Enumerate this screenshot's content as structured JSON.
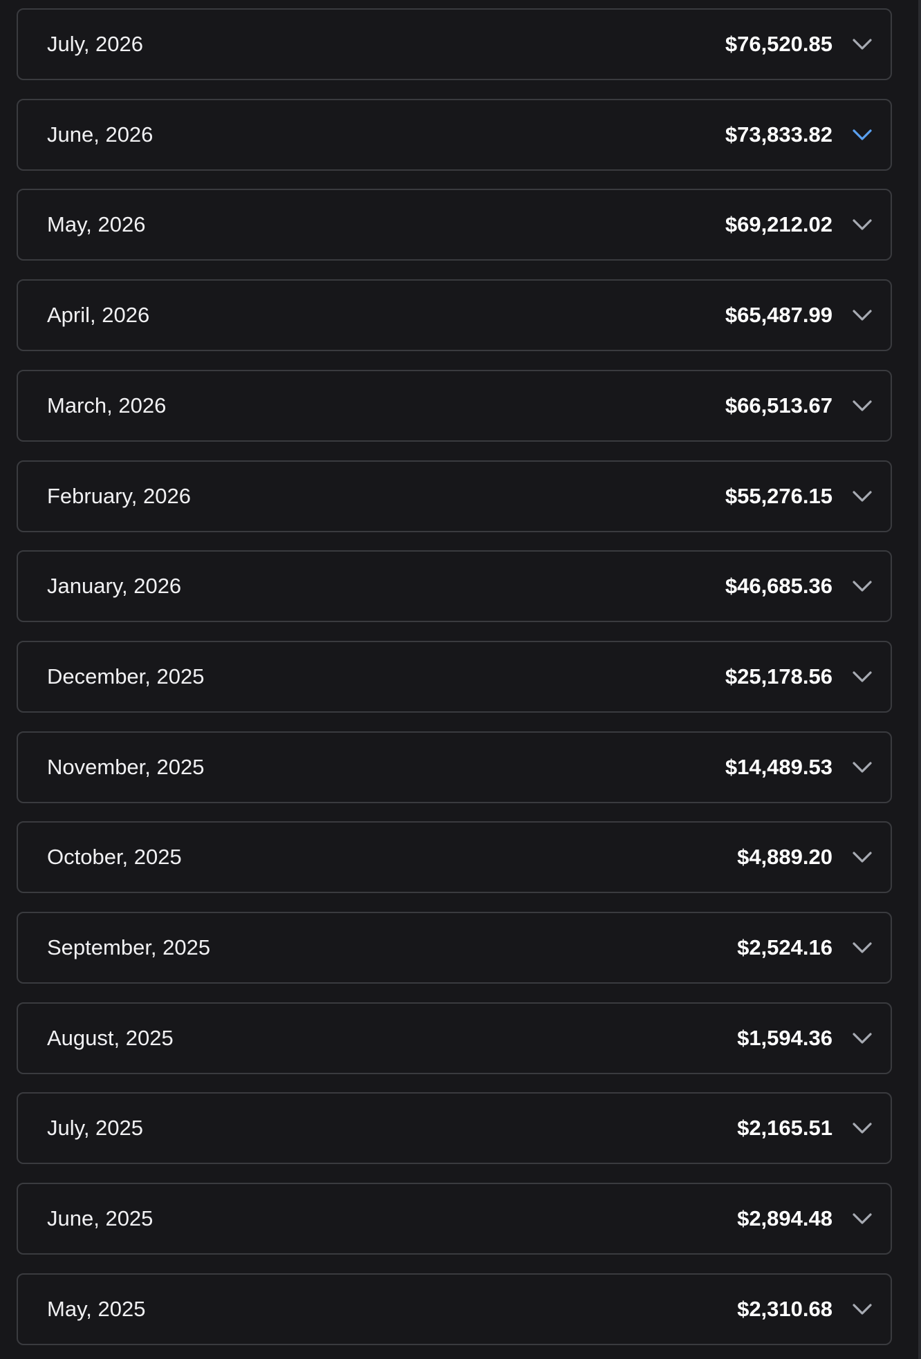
{
  "colors": {
    "background": "#17171a",
    "row_border": "#3a3b3f",
    "chevron": "#a7abb3",
    "chevron_active": "#5aa0f0",
    "text": "#f1f1f3"
  },
  "months": [
    {
      "label": "July, 2026",
      "amount": "$76,520.85",
      "icon": "chevron-down-icon",
      "active": false
    },
    {
      "label": "June, 2026",
      "amount": "$73,833.82",
      "icon": "chevron-down-icon",
      "active": true
    },
    {
      "label": "May, 2026",
      "amount": "$69,212.02",
      "icon": "chevron-down-icon",
      "active": false
    },
    {
      "label": "April, 2026",
      "amount": "$65,487.99",
      "icon": "chevron-down-icon",
      "active": false
    },
    {
      "label": "March, 2026",
      "amount": "$66,513.67",
      "icon": "chevron-down-icon",
      "active": false
    },
    {
      "label": "February, 2026",
      "amount": "$55,276.15",
      "icon": "chevron-down-icon",
      "active": false
    },
    {
      "label": "January, 2026",
      "amount": "$46,685.36",
      "icon": "chevron-down-icon",
      "active": false
    },
    {
      "label": "December, 2025",
      "amount": "$25,178.56",
      "icon": "chevron-down-icon",
      "active": false
    },
    {
      "label": "November, 2025",
      "amount": "$14,489.53",
      "icon": "chevron-down-icon",
      "active": false
    },
    {
      "label": "October, 2025",
      "amount": "$4,889.20",
      "icon": "chevron-down-icon",
      "active": false
    },
    {
      "label": "September, 2025",
      "amount": "$2,524.16",
      "icon": "chevron-down-icon",
      "active": false
    },
    {
      "label": "August, 2025",
      "amount": "$1,594.36",
      "icon": "chevron-down-icon",
      "active": false
    },
    {
      "label": "July, 2025",
      "amount": "$2,165.51",
      "icon": "chevron-down-icon",
      "active": false
    },
    {
      "label": "June, 2025",
      "amount": "$2,894.48",
      "icon": "chevron-down-icon",
      "active": false
    },
    {
      "label": "May, 2025",
      "amount": "$2,310.68",
      "icon": "chevron-down-icon",
      "active": false
    }
  ]
}
